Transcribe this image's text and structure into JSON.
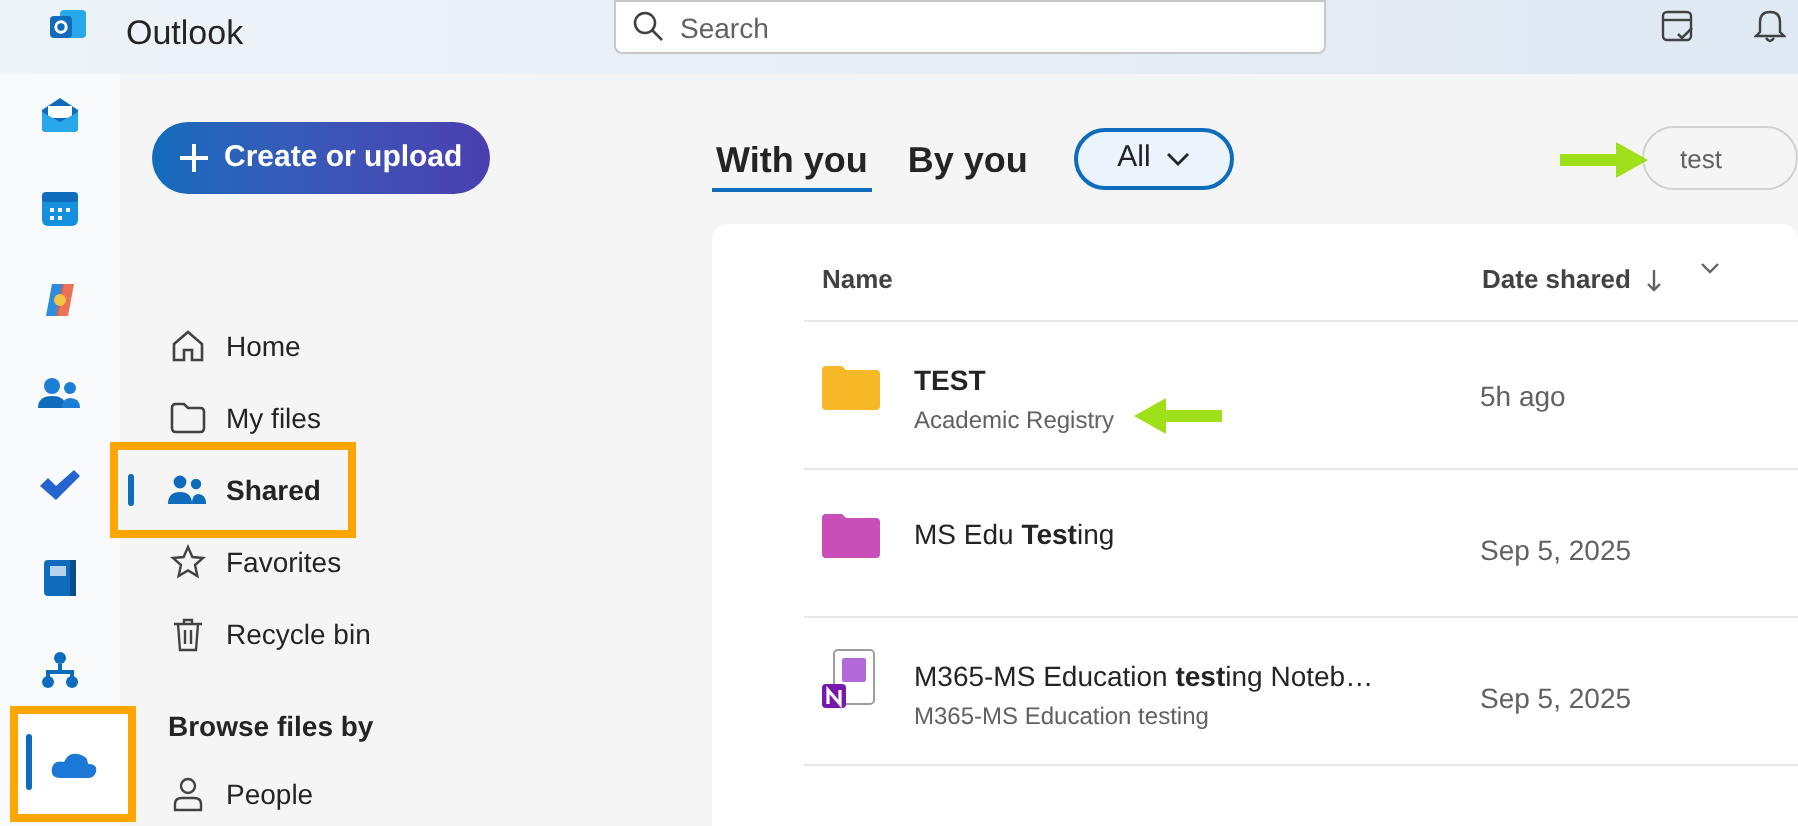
{
  "app": {
    "title": "Outlook"
  },
  "search": {
    "placeholder": "Search"
  },
  "rail": [
    {
      "kind": "mail",
      "selected": false,
      "highlighted": false
    },
    {
      "kind": "calendar",
      "selected": false,
      "highlighted": false
    },
    {
      "kind": "copilot",
      "selected": false,
      "highlighted": false
    },
    {
      "kind": "people",
      "selected": false,
      "highlighted": false
    },
    {
      "kind": "todo",
      "selected": false,
      "highlighted": false
    },
    {
      "kind": "apps",
      "selected": false,
      "highlighted": false
    },
    {
      "kind": "org",
      "selected": false,
      "highlighted": false
    },
    {
      "kind": "onedrive",
      "selected": true,
      "highlighted": true
    }
  ],
  "create_button": {
    "label": "Create or upload"
  },
  "nav": [
    {
      "kind": "home",
      "label": "Home",
      "selected": false,
      "highlighted": false
    },
    {
      "kind": "folder",
      "label": "My files",
      "selected": false,
      "highlighted": false
    },
    {
      "kind": "shared",
      "label": "Shared",
      "selected": true,
      "highlighted": true
    },
    {
      "kind": "star",
      "label": "Favorites",
      "selected": false,
      "highlighted": false
    },
    {
      "kind": "trash",
      "label": "Recycle bin",
      "selected": false,
      "highlighted": false
    }
  ],
  "browse": {
    "heading": "Browse files by",
    "items": [
      {
        "kind": "person",
        "label": "People"
      }
    ]
  },
  "tabs": [
    {
      "label": "With you",
      "selected": true
    },
    {
      "label": "By you",
      "selected": false
    }
  ],
  "filter": {
    "label": "All"
  },
  "filter_search": {
    "value": "test",
    "arrow": true
  },
  "table": {
    "columns": [
      {
        "label": "Name",
        "sorted": false
      },
      {
        "label": "Date shared",
        "sorted": true
      }
    ],
    "rows": [
      {
        "kind": "folder",
        "color": "#f7b928",
        "name": "TEST",
        "bold": true,
        "subtitle": "Academic Registry",
        "date": "5h ago",
        "arrow": true
      },
      {
        "kind": "folder",
        "color": "#c94fb8",
        "name": "MS Edu **Test**ing",
        "bold": false,
        "date": "Sep 5, 2025",
        "arrow": false
      },
      {
        "kind": "notebook",
        "name": "M365-MS Education **test**ing Noteb…",
        "bold": false,
        "subtitle": "M365-MS Education testing",
        "date": "Sep 5, 2025",
        "arrow": false
      }
    ]
  }
}
